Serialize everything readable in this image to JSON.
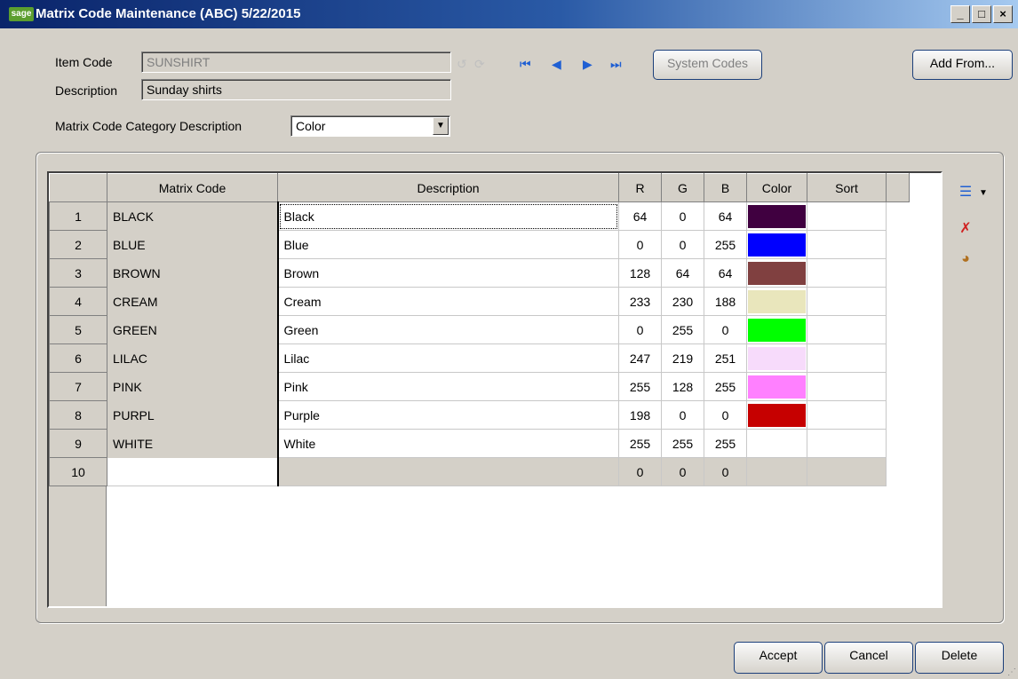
{
  "window": {
    "logo": "sage",
    "title": "Matrix Code Maintenance (ABC) 5/22/2015",
    "controls": {
      "minimize": "_",
      "maximize": "□",
      "close": "×"
    }
  },
  "form": {
    "item_code_label": "Item Code",
    "item_code_value": "SUNSHIRT",
    "description_label": "Description",
    "description_value": "Sunday shirts",
    "category_label": "Matrix Code Category Description",
    "category_value": "Color",
    "system_codes_button": "System Codes",
    "add_from_button": "Add From..."
  },
  "nav_icons": [
    "lookup-icon",
    "refresh-icon",
    "first-record-icon",
    "previous-record-icon",
    "next-record-icon",
    "last-record-icon"
  ],
  "grid": {
    "columns": [
      "Matrix Code",
      "Description",
      "R",
      "G",
      "B",
      "Color",
      "Sort"
    ],
    "rows": [
      {
        "num": "1",
        "code": "BLACK",
        "desc": "Black",
        "r": "64",
        "g": "0",
        "b": "64",
        "color": "#400040",
        "sort": ""
      },
      {
        "num": "2",
        "code": "BLUE",
        "desc": "Blue",
        "r": "0",
        "g": "0",
        "b": "255",
        "color": "#0000ff",
        "sort": ""
      },
      {
        "num": "3",
        "code": "BROWN",
        "desc": "Brown",
        "r": "128",
        "g": "64",
        "b": "64",
        "color": "#804040",
        "sort": ""
      },
      {
        "num": "4",
        "code": "CREAM",
        "desc": "Cream",
        "r": "233",
        "g": "230",
        "b": "188",
        "color": "#e9e6bc",
        "sort": ""
      },
      {
        "num": "5",
        "code": "GREEN",
        "desc": "Green",
        "r": "0",
        "g": "255",
        "b": "0",
        "color": "#00ff00",
        "sort": ""
      },
      {
        "num": "6",
        "code": "LILAC",
        "desc": "Lilac",
        "r": "247",
        "g": "219",
        "b": "251",
        "color": "#f7dbfb",
        "sort": ""
      },
      {
        "num": "7",
        "code": "PINK",
        "desc": "Pink",
        "r": "255",
        "g": "128",
        "b": "255",
        "color": "#ff80ff",
        "sort": ""
      },
      {
        "num": "8",
        "code": "PURPL",
        "desc": "Purple",
        "r": "198",
        "g": "0",
        "b": "0",
        "color": "#c60000",
        "sort": ""
      },
      {
        "num": "9",
        "code": "WHITE",
        "desc": "White",
        "r": "255",
        "g": "255",
        "b": "255",
        "color": "#ffffff",
        "sort": ""
      },
      {
        "num": "10",
        "code": "",
        "desc": "",
        "r": "0",
        "g": "0",
        "b": "0",
        "color": "",
        "sort": ""
      }
    ]
  },
  "side_icons": [
    "insert-row-icon",
    "delete-row-icon",
    "color-palette-icon"
  ],
  "buttons": {
    "accept": "Accept",
    "cancel": "Cancel",
    "delete": "Delete"
  }
}
